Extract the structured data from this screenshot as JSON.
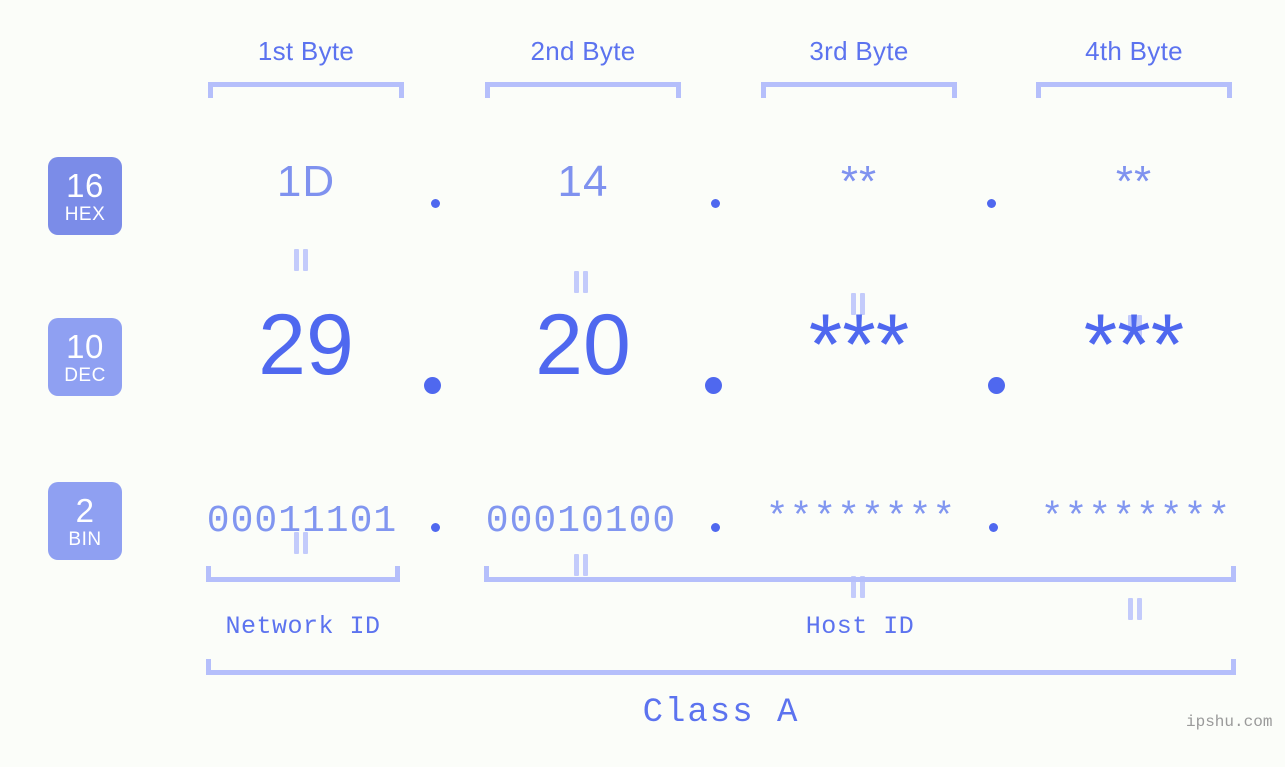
{
  "meta": {
    "watermark": "ipshu.com",
    "background_color": "#fbfdf9",
    "accent_color": "#5c73ef",
    "accent_light_color": "#b5bffb",
    "value_color": "#7f92ef",
    "dec_color": "#4f68ef",
    "badge_color": "#7b8ce8",
    "badge_color_light": "#8fa0f2"
  },
  "byte_headers": [
    {
      "label": "1st Byte"
    },
    {
      "label": "2nd Byte"
    },
    {
      "label": "3rd Byte"
    },
    {
      "label": "4th Byte"
    }
  ],
  "rows": [
    {
      "id": "hex",
      "badge": {
        "num": "16",
        "name": "HEX"
      },
      "values": [
        "1D",
        "14",
        "**",
        "**"
      ],
      "separator": "."
    },
    {
      "id": "dec",
      "badge": {
        "num": "10",
        "name": "DEC"
      },
      "values": [
        "29",
        "20",
        "***",
        "***"
      ],
      "separator": "."
    },
    {
      "id": "bin",
      "badge": {
        "num": "2",
        "name": "BIN"
      },
      "values": [
        "00011101",
        "00010100",
        "********",
        "********"
      ],
      "separator": "."
    }
  ],
  "connectors": {
    "symbol": "=",
    "rows": 2,
    "columns": 4
  },
  "id_sections": [
    {
      "label": "Network ID",
      "spans_bytes": [
        1
      ]
    },
    {
      "label": "Host ID",
      "spans_bytes": [
        2,
        3,
        4
      ]
    }
  ],
  "class": {
    "label": "Class A",
    "spans_bytes": [
      1,
      2,
      3,
      4
    ]
  }
}
